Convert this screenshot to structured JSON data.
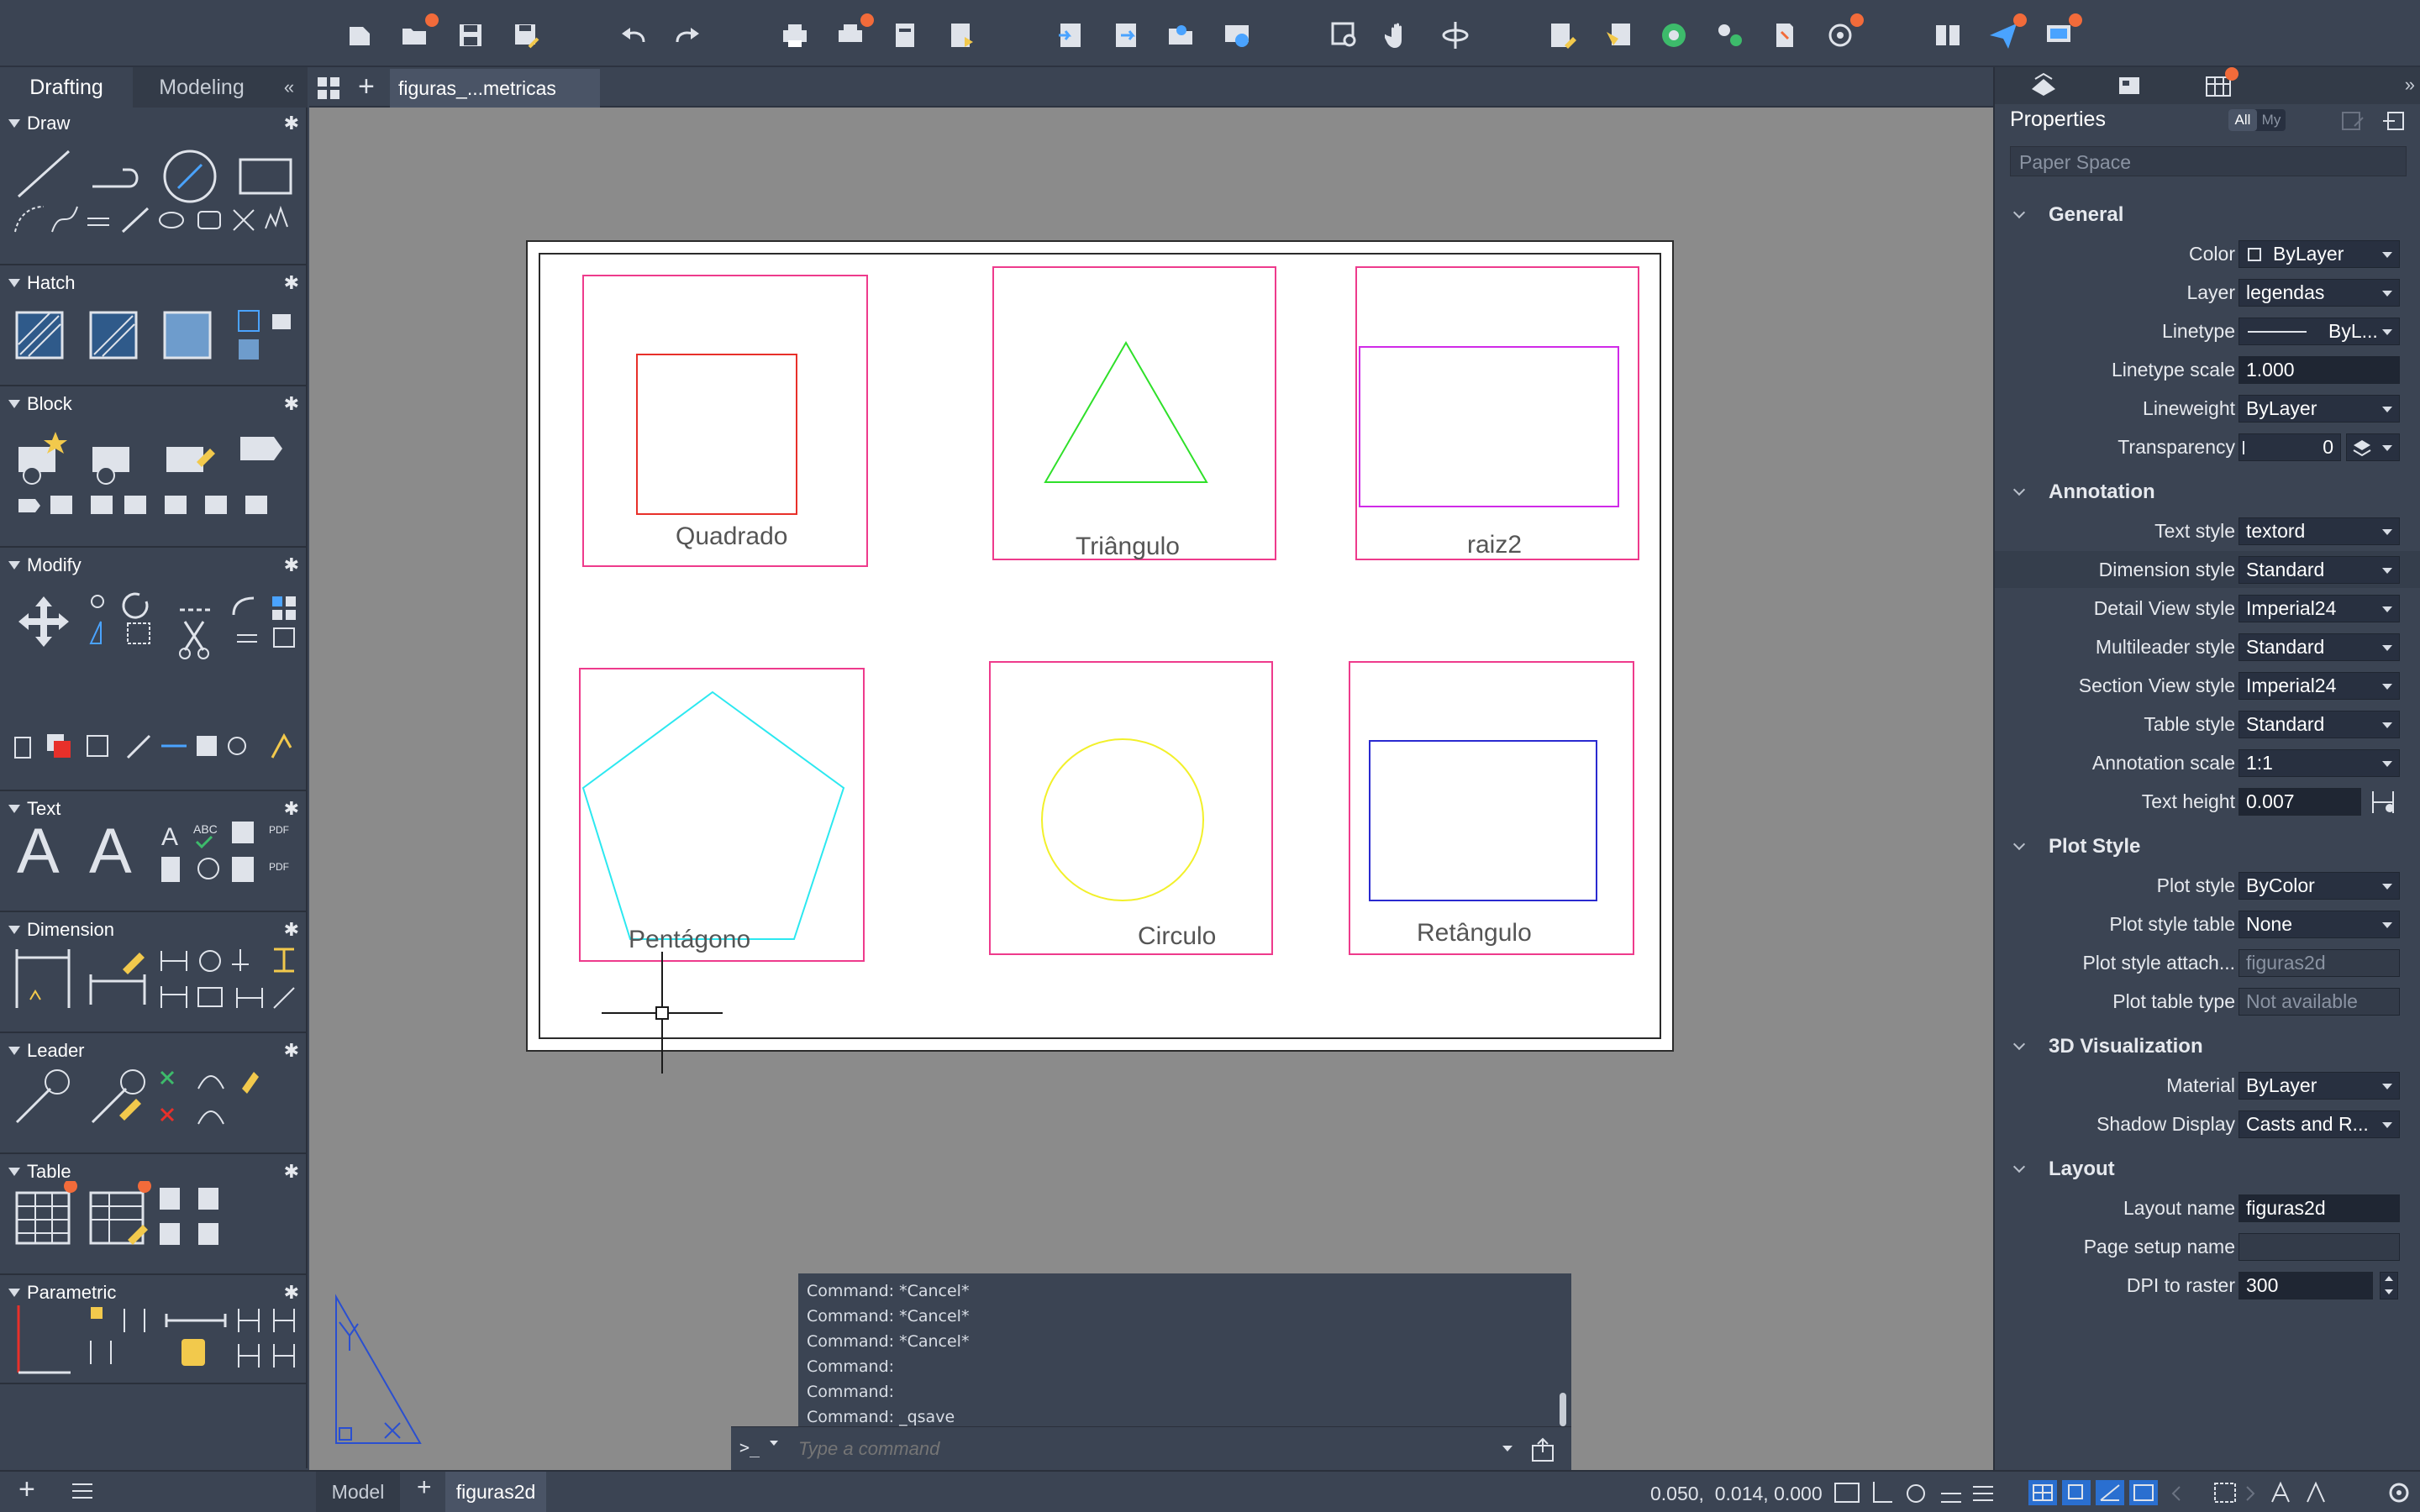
{
  "left_panel": {
    "tabs": [
      {
        "label": "Drafting"
      },
      {
        "label": "Modeling"
      }
    ],
    "sections": {
      "draw": "Draw",
      "hatch": "Hatch",
      "block": "Block",
      "modify": "Modify",
      "text": "Text",
      "dimension": "Dimension",
      "leader": "Leader",
      "table": "Table",
      "parametric": "Parametric"
    }
  },
  "document": {
    "tab_title": "figuras_...metricas"
  },
  "drawing": {
    "labels": {
      "square": "Quadrado",
      "triangle": "Triângulo",
      "root2": "raiz2",
      "pentagon": "Pentágono",
      "circle": "Circulo",
      "rectangle": "Retângulo"
    },
    "colors": {
      "frame": "#ee3b8c",
      "square": "#e8302a",
      "triangle": "#2fe02a",
      "root2": "#d02ae8",
      "pentagon": "#2ce8f0",
      "circle": "#f2f02a",
      "rectangle": "#2a2ad0"
    }
  },
  "properties": {
    "title": "Properties",
    "filter_all": "All",
    "filter_my": "My",
    "selector": "Paper Space",
    "sections": {
      "general": "General",
      "annotation": "Annotation",
      "plot_style": "Plot Style",
      "visualization": "3D Visualization",
      "layout": "Layout"
    },
    "general": {
      "color_label": "Color",
      "color_value": "ByLayer",
      "layer_label": "Layer",
      "layer_value": "legendas",
      "linetype_label": "Linetype",
      "linetype_value": "ByL...",
      "linetype_scale_label": "Linetype scale",
      "linetype_scale_value": "1.000",
      "lineweight_label": "Lineweight",
      "lineweight_value": "ByLayer",
      "transparency_label": "Transparency",
      "transparency_value": "0"
    },
    "annotation": {
      "text_style_label": "Text style",
      "text_style_value": "textord",
      "dimension_style_label": "Dimension style",
      "dimension_style_value": "Standard",
      "detail_view_label": "Detail View style",
      "detail_view_value": "Imperial24",
      "multileader_label": "Multileader style",
      "multileader_value": "Standard",
      "section_view_label": "Section View style",
      "section_view_value": "Imperial24",
      "table_style_label": "Table style",
      "table_style_value": "Standard",
      "annotation_scale_label": "Annotation scale",
      "annotation_scale_value": "1:1",
      "text_height_label": "Text height",
      "text_height_value": "0.007"
    },
    "plot_style": {
      "plot_style_label": "Plot style",
      "plot_style_value": "ByColor",
      "plot_style_table_label": "Plot style table",
      "plot_style_table_value": "None",
      "plot_style_attach_label": "Plot style attach...",
      "plot_style_attach_value": "figuras2d",
      "plot_table_type_label": "Plot table type",
      "plot_table_type_value": "Not available"
    },
    "visualization": {
      "material_label": "Material",
      "material_value": "ByLayer",
      "shadow_label": "Shadow Display",
      "shadow_value": "Casts and R..."
    },
    "layout": {
      "layout_name_label": "Layout name",
      "layout_name_value": "figuras2d",
      "page_setup_label": "Page setup name",
      "page_setup_value": "",
      "dpi_label": "DPI to raster",
      "dpi_value": "300"
    }
  },
  "command": {
    "history": [
      "Command: *Cancel*",
      "Command: *Cancel*",
      "Command: *Cancel*",
      "Command:",
      "Command:",
      "Command: _qsave"
    ],
    "prompt": ">_",
    "placeholder": "Type a command"
  },
  "status": {
    "model_tab": "Model",
    "layout_tab": "figuras2d",
    "coordinates": "0.050,  0.014, 0.000"
  }
}
